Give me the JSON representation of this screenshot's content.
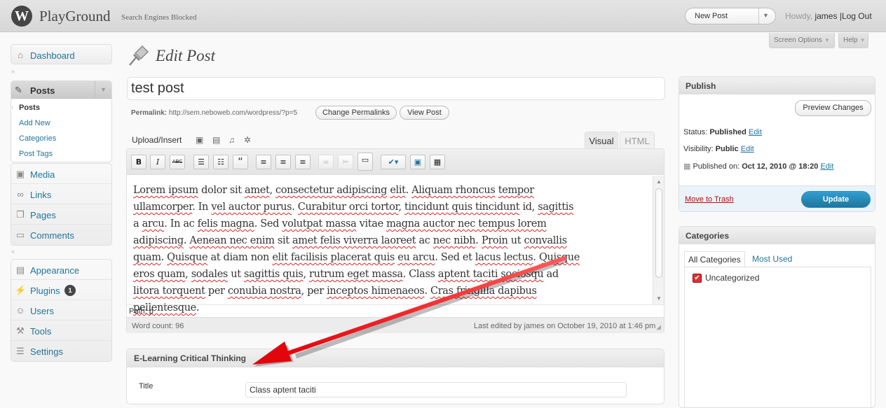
{
  "header": {
    "logo_letter": "W",
    "site_name": "PlayGround",
    "site_status": "Search Engines Blocked",
    "new_post_label": "New Post",
    "howdy_prefix": "Howdy,",
    "username": "james",
    "separator": "|",
    "logout_label": "Log Out"
  },
  "screen_tabs": {
    "screen_options": "Screen Options",
    "help": "Help"
  },
  "menu": {
    "dashboard": "Dashboard",
    "posts": "Posts",
    "posts_sub": [
      "Posts",
      "Add New",
      "Categories",
      "Post Tags"
    ],
    "media": "Media",
    "links": "Links",
    "pages": "Pages",
    "comments": "Comments",
    "appearance": "Appearance",
    "plugins": "Plugins",
    "plugins_badge": "1",
    "users": "Users",
    "tools": "Tools",
    "settings": "Settings"
  },
  "page": {
    "title": "Edit Post",
    "post_title": "test post",
    "permalink_label": "Permalink:",
    "permalink_url": "http://sem.neboweb.com/wordpress/?p=5",
    "change_permalinks": "Change Permalinks",
    "view_post": "View Post"
  },
  "editor": {
    "upload_insert": "Upload/Insert",
    "tab_visual": "Visual",
    "tab_html": "HTML",
    "toolbar": {
      "bold": "B",
      "italic": "I",
      "strike": "ABC",
      "blockquote": "“"
    },
    "path_label": "Path:",
    "path_value": "p",
    "word_count": "Word count: 96",
    "last_edited": "Last edited by james on October 19, 2010 at 1:46 pm"
  },
  "content_segments": [
    {
      "t": "Lorem ipsum",
      "sq": true
    },
    {
      "t": " dolor sit ",
      "sq": false
    },
    {
      "t": "amet",
      "sq": true
    },
    {
      "t": ", ",
      "sq": false
    },
    {
      "t": "consectetur adipiscing",
      "sq": true
    },
    {
      "t": " ",
      "sq": false
    },
    {
      "t": "elit",
      "sq": true
    },
    {
      "t": ". ",
      "sq": false
    },
    {
      "t": "Aliquam rhoncus",
      "sq": true
    },
    {
      "t": " ",
      "sq": false
    },
    {
      "t": "tempor",
      "sq": true
    },
    {
      "t": " ",
      "sq": false
    },
    {
      "t": "ullamcorper",
      "sq": true
    },
    {
      "t": ". In ",
      "sq": false
    },
    {
      "t": "vel auctor purus",
      "sq": true
    },
    {
      "t": ". ",
      "sq": false
    },
    {
      "t": "Curabitur orci tortor",
      "sq": true
    },
    {
      "t": ", ",
      "sq": false
    },
    {
      "t": "tincidunt quis tincidunt",
      "sq": true
    },
    {
      "t": " id, ",
      "sq": false
    },
    {
      "t": "sagittis",
      "sq": true
    },
    {
      "t": " a ",
      "sq": false
    },
    {
      "t": "arcu",
      "sq": true
    },
    {
      "t": ". In ac ",
      "sq": false
    },
    {
      "t": "felis magna",
      "sq": true
    },
    {
      "t": ". Sed ",
      "sq": false
    },
    {
      "t": "volutpat massa",
      "sq": true
    },
    {
      "t": " vitae ",
      "sq": false
    },
    {
      "t": "magna auctor nec tempus lorem adipiscing",
      "sq": true
    },
    {
      "t": ". ",
      "sq": false
    },
    {
      "t": "Aenean nec enim",
      "sq": true
    },
    {
      "t": " sit ",
      "sq": false
    },
    {
      "t": "amet felis viverra laoreet",
      "sq": true
    },
    {
      "t": " ac ",
      "sq": false
    },
    {
      "t": "nec nibh",
      "sq": true
    },
    {
      "t": ". ",
      "sq": false
    },
    {
      "t": "Proin",
      "sq": true
    },
    {
      "t": " ut ",
      "sq": false
    },
    {
      "t": "convallis quam",
      "sq": true
    },
    {
      "t": ". ",
      "sq": false
    },
    {
      "t": "Quisque",
      "sq": true
    },
    {
      "t": " ",
      "sq": false
    },
    {
      "t": "at diam non ",
      "sq": false
    },
    {
      "t": "elit facilisis placerat quis",
      "sq": true
    },
    {
      "t": " ",
      "sq": false
    },
    {
      "t": "eu arcu",
      "sq": true
    },
    {
      "t": ". Sed et ",
      "sq": false
    },
    {
      "t": "lacus lectus",
      "sq": true
    },
    {
      "t": ". ",
      "sq": false
    },
    {
      "t": "Quisque eros quam",
      "sq": true
    },
    {
      "t": ", ",
      "sq": false
    },
    {
      "t": "sodales",
      "sq": true
    },
    {
      "t": " ut ",
      "sq": false
    },
    {
      "t": "sagittis quis",
      "sq": true
    },
    {
      "t": ", ",
      "sq": false
    },
    {
      "t": "rutrum eget massa",
      "sq": true
    },
    {
      "t": ". Class ",
      "sq": false
    },
    {
      "t": "aptent taciti sociosqu",
      "sq": true
    },
    {
      "t": " ad ",
      "sq": false
    },
    {
      "t": "litora torquent",
      "sq": true
    },
    {
      "t": " per ",
      "sq": false
    },
    {
      "t": "conubia nostra",
      "sq": true
    },
    {
      "t": ", per ",
      "sq": false
    },
    {
      "t": "inceptos himenaeos",
      "sq": true
    },
    {
      "t": ". ",
      "sq": false
    },
    {
      "t": "Cras fringilla dapibus pellentesque",
      "sq": true
    },
    {
      "t": ".",
      "sq": false
    }
  ],
  "meta_box": {
    "heading": "E-Learning Critical Thinking",
    "title_label": "Title",
    "title_value": "Class aptent taciti"
  },
  "publish": {
    "heading": "Publish",
    "preview_changes": "Preview Changes",
    "status_label": "Status:",
    "status_value": "Published",
    "visibility_label": "Visibility:",
    "visibility_value": "Public",
    "published_label": "Published on:",
    "published_value": "Oct 12, 2010 @ 18:20",
    "edit_label": "Edit",
    "move_to_trash": "Move to Trash",
    "update": "Update"
  },
  "categories": {
    "heading": "Categories",
    "tab_all": "All Categories",
    "tab_most_used": "Most Used",
    "items": [
      "Uncategorized"
    ]
  },
  "colors": {
    "link": "#21759b",
    "annotation_arrow": "#e3050c",
    "update_button": "#21759b",
    "trash": "#bc0b0b"
  },
  "icons": {
    "logo": "wordpress-logo",
    "page_title": "pushpin-icon",
    "dashboard": "house-icon",
    "posts": "pushpin-icon",
    "media": "media-icon",
    "links": "link-icon",
    "pages": "pages-icon",
    "comments": "comment-icon",
    "appearance": "paintbrush-icon",
    "plugins": "plug-icon",
    "users": "users-icon",
    "tools": "tools-icon",
    "settings": "settings-icon"
  }
}
